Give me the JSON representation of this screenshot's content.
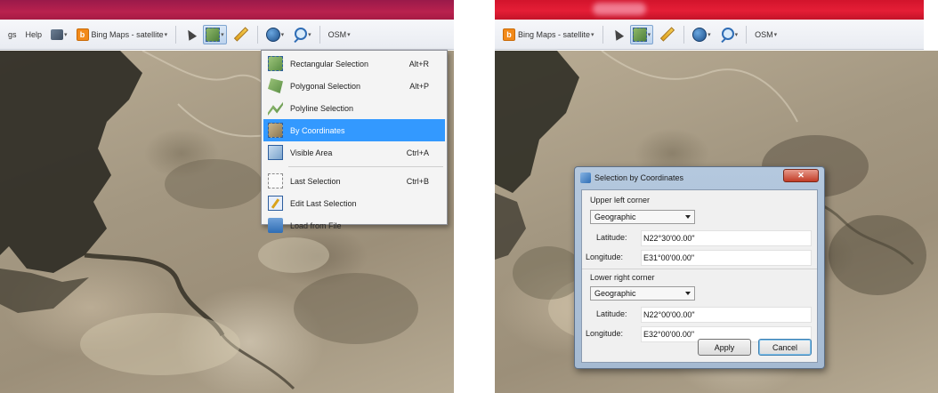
{
  "left_panel": {
    "toolbar": {
      "menu_fragment": "gs",
      "help": "Help",
      "maps_dropdown": "Bing Maps - satellite",
      "osm": "OSM"
    },
    "selection_menu": {
      "items": [
        {
          "label": "Rectangular Selection",
          "shortcut": "Alt+R",
          "icon": "rectangle-selection-icon"
        },
        {
          "label": "Polygonal Selection",
          "shortcut": "Alt+P",
          "icon": "polygon-selection-icon"
        },
        {
          "label": "Polyline Selection",
          "shortcut": "",
          "icon": "polyline-selection-icon"
        },
        {
          "label": "By Coordinates",
          "shortcut": "",
          "icon": "coordinates-selection-icon",
          "highlighted": true
        },
        {
          "label": "Visible Area",
          "shortcut": "Ctrl+A",
          "icon": "visible-area-icon"
        },
        {
          "label": "Last Selection",
          "shortcut": "Ctrl+B",
          "icon": "last-selection-icon"
        },
        {
          "label": "Edit Last Selection",
          "shortcut": "",
          "icon": "edit-selection-icon"
        },
        {
          "label": "Load from File",
          "shortcut": "",
          "icon": "load-file-icon"
        }
      ]
    }
  },
  "right_panel": {
    "toolbar": {
      "maps_dropdown": "Bing Maps - satellite",
      "osm": "OSM"
    },
    "dialog": {
      "title": "Selection by Coordinates",
      "upper_left": {
        "group_label": "Upper left corner",
        "system": "Geographic",
        "latitude_label": "Latitude:",
        "latitude_value": "N22°30'00.00\"",
        "longitude_label": "Longitude:",
        "longitude_value": "E31°00'00.00\""
      },
      "lower_right": {
        "group_label": "Lower right corner",
        "system": "Geographic",
        "latitude_label": "Latitude:",
        "latitude_value": "N22°00'00.00\"",
        "longitude_label": "Longitude:",
        "longitude_value": "E32°00'00.00\""
      },
      "apply_label": "Apply",
      "cancel_label": "Cancel",
      "close_symbol": "✕"
    }
  }
}
